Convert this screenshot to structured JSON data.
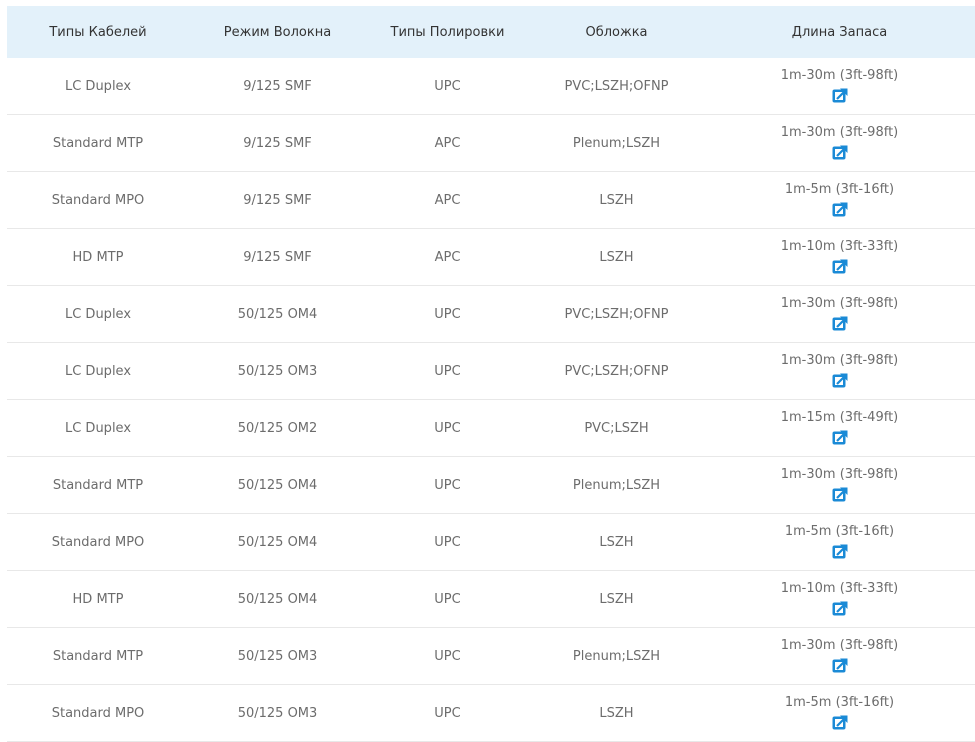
{
  "colors": {
    "header_bg": "#e3f1fa",
    "link_icon": "#1a8ad6"
  },
  "headers": [
    "Типы Кабелей",
    "Режим Волокна",
    "Типы Полировки",
    "Обложка",
    "Длина Запаса"
  ],
  "rows": [
    {
      "cable": "LC Duplex",
      "mode": "9/125 SMF",
      "polish": "UPC",
      "jacket": "PVC;LSZH;OFNP",
      "length": "1m-30m (3ft-98ft)",
      "icon": "external-link-icon"
    },
    {
      "cable": "Standard MTP",
      "mode": "9/125 SMF",
      "polish": "APC",
      "jacket": "Plenum;LSZH",
      "length": "1m-30m (3ft-98ft)",
      "icon": "external-link-icon"
    },
    {
      "cable": "Standard MPO",
      "mode": "9/125 SMF",
      "polish": "APC",
      "jacket": "LSZH",
      "length": "1m-5m (3ft-16ft)",
      "icon": "external-link-icon"
    },
    {
      "cable": "HD MTP",
      "mode": "9/125 SMF",
      "polish": "APC",
      "jacket": "LSZH",
      "length": "1m-10m (3ft-33ft)",
      "icon": "external-link-icon"
    },
    {
      "cable": "LC Duplex",
      "mode": "50/125 OM4",
      "polish": "UPC",
      "jacket": "PVC;LSZH;OFNP",
      "length": "1m-30m (3ft-98ft)",
      "icon": "external-link-icon"
    },
    {
      "cable": "LC Duplex",
      "mode": "50/125 OM3",
      "polish": "UPC",
      "jacket": "PVC;LSZH;OFNP",
      "length": "1m-30m (3ft-98ft)",
      "icon": "external-link-icon"
    },
    {
      "cable": "LC Duplex",
      "mode": "50/125 OM2",
      "polish": "UPC",
      "jacket": "PVC;LSZH",
      "length": "1m-15m (3ft-49ft)",
      "icon": "external-link-icon"
    },
    {
      "cable": "Standard MTP",
      "mode": "50/125 OM4",
      "polish": "UPC",
      "jacket": "Plenum;LSZH",
      "length": "1m-30m (3ft-98ft)",
      "icon": "external-link-icon"
    },
    {
      "cable": "Standard MPO",
      "mode": "50/125 OM4",
      "polish": "UPC",
      "jacket": "LSZH",
      "length": "1m-5m (3ft-16ft)",
      "icon": "external-link-icon"
    },
    {
      "cable": "HD MTP",
      "mode": "50/125 OM4",
      "polish": "UPC",
      "jacket": "LSZH",
      "length": "1m-10m (3ft-33ft)",
      "icon": "external-link-icon"
    },
    {
      "cable": "Standard MTP",
      "mode": "50/125 OM3",
      "polish": "UPC",
      "jacket": "Plenum;LSZH",
      "length": "1m-30m (3ft-98ft)",
      "icon": "external-link-icon"
    },
    {
      "cable": "Standard MPO",
      "mode": "50/125 OM3",
      "polish": "UPC",
      "jacket": "LSZH",
      "length": "1m-5m (3ft-16ft)",
      "icon": "external-link-icon"
    }
  ]
}
